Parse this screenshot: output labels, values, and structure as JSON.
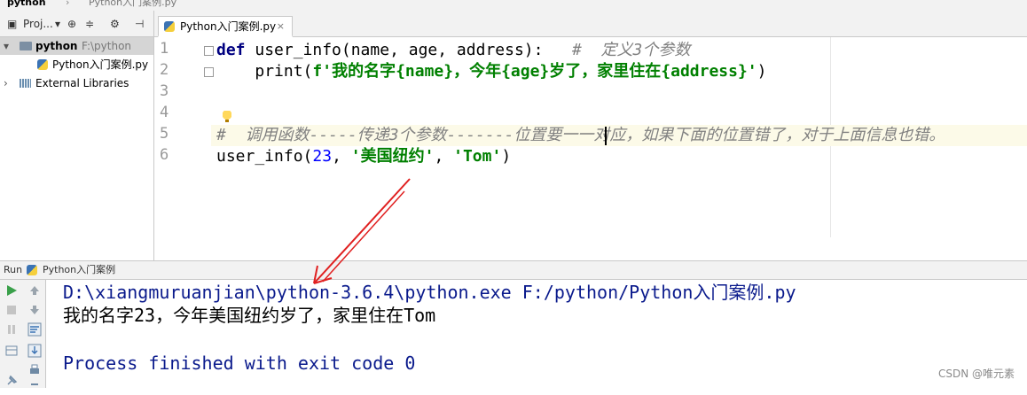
{
  "breadcrumb": {
    "project": "python",
    "file": "Python入门案例.py"
  },
  "project_panel": {
    "toolbar_label": "Proj...",
    "items": [
      {
        "label": "python",
        "path": "F:\\python"
      },
      {
        "label": "Python入门案例.py"
      },
      {
        "label": "External Libraries"
      }
    ]
  },
  "editor": {
    "tab_label": "Python入门案例.py",
    "line_numbers": [
      "1",
      "2",
      "3",
      "4",
      "5",
      "6"
    ],
    "lines": {
      "l1_kw": "def",
      "l1_code": " user_info(name, age, address):   ",
      "l1_comment": "#  定义3个参数",
      "l2_fn": "print(",
      "l2_str": "f'我的名字{name}，今年{age}岁了，家里住在{address}'",
      "l2_end": ")",
      "l5_comment": "#  调用函数-----传递3个参数-------位置要一一对应，如果下面的位置错了，对于上面信息也错。",
      "l6_fn": "user_info(",
      "l6_num": "23",
      "l6_sep1": ", ",
      "l6_str1": "'美国纽约'",
      "l6_sep2": ", ",
      "l6_str2": "'Tom'",
      "l6_end": ")"
    }
  },
  "run_panel": {
    "header_label": "Run",
    "config_name": "Python入门案例",
    "console_lines": [
      "D:\\xiangmuruanjian\\python-3.6.4\\python.exe F:/python/Python入门案例.py",
      "我的名字23，今年美国纽约岁了，家里住在Tom",
      "",
      "Process finished with exit code 0"
    ]
  },
  "watermark": "CSDN @唯元素",
  "colors": {
    "keyword": "#000080",
    "string": "#008000",
    "number": "#0000ff",
    "comment": "#808080",
    "console_blue": "#0a1a8c",
    "arrow": "#e02020"
  }
}
